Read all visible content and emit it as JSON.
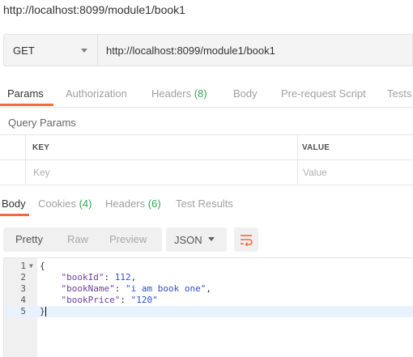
{
  "request": {
    "title": "http://localhost:8099/module1/book1",
    "method": "GET",
    "url": "http://localhost:8099/module1/book1"
  },
  "request_tabs": [
    {
      "label": "Params",
      "count": ""
    },
    {
      "label": "Authorization",
      "count": ""
    },
    {
      "label": "Headers",
      "count": "(8)"
    },
    {
      "label": "Body",
      "count": ""
    },
    {
      "label": "Pre-request Script",
      "count": ""
    },
    {
      "label": "Tests",
      "count": ""
    }
  ],
  "query_params": {
    "label": "Query Params",
    "columns": [
      "KEY",
      "VALUE"
    ],
    "placeholder_key": "Key",
    "placeholder_value": "Value"
  },
  "response_tabs": [
    {
      "label": "Body",
      "count": ""
    },
    {
      "label": "Cookies",
      "count": "(4)"
    },
    {
      "label": "Headers",
      "count": "(6)"
    },
    {
      "label": "Test Results",
      "count": ""
    }
  ],
  "view_modes": [
    "Pretty",
    "Raw",
    "Preview"
  ],
  "format": "JSON",
  "icons": {
    "method_dropdown": "chevron-down-icon",
    "format_dropdown": "chevron-down-icon",
    "wrap": "wrap-lines-icon",
    "fold": "fold-arrow-icon"
  },
  "colors": {
    "accent": "#f26b3a",
    "count": "#34a853",
    "string": "#2a4fd6",
    "key": "#6b3fa0"
  },
  "response_body": {
    "line_numbers": [
      "1",
      "2",
      "3",
      "4",
      "5"
    ],
    "lines": [
      {
        "text": "{"
      },
      {
        "key": "\"bookId\"",
        "sep": ": ",
        "value": "112",
        "tail": ","
      },
      {
        "key": "\"bookName\"",
        "sep": ": ",
        "value": "\"i am book one\"",
        "tail": ","
      },
      {
        "key": "\"bookPrice\"",
        "sep": ": ",
        "value": "\"120\"",
        "tail": ""
      },
      {
        "text": "}"
      }
    ]
  }
}
